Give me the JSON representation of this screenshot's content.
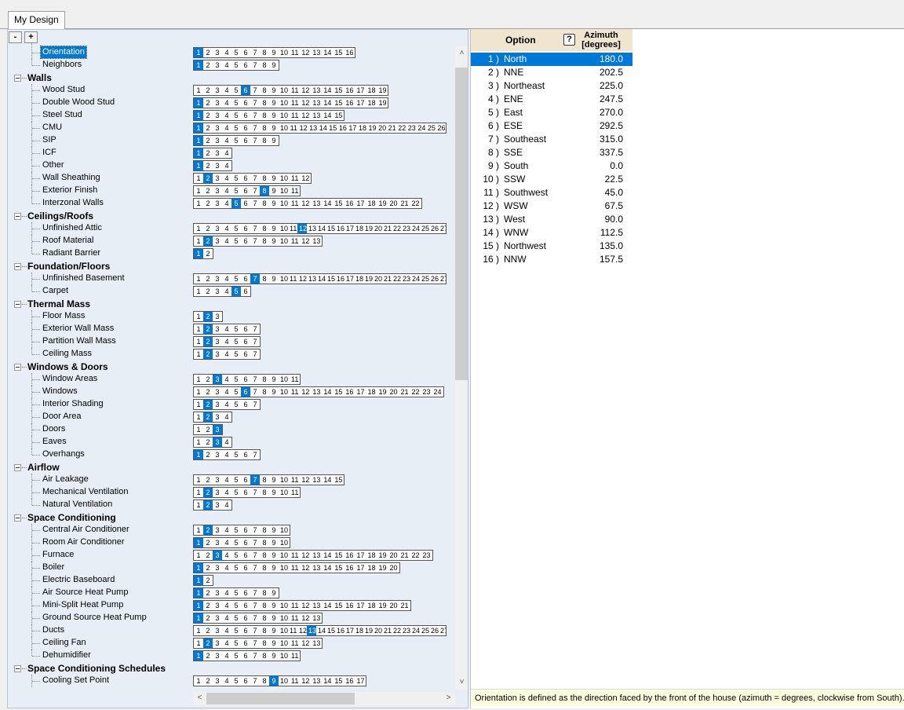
{
  "tab": {
    "label": "My Design"
  },
  "expand_buttons": {
    "collapse": "-",
    "expand": "+"
  },
  "tree": [
    {
      "type": "item",
      "label": "Orientation",
      "count": 16,
      "sel": 1,
      "selected": true,
      "first": true
    },
    {
      "type": "item",
      "label": "Neighbors",
      "count": 9,
      "sel": 1,
      "last": true
    },
    {
      "type": "cat",
      "label": "Walls"
    },
    {
      "type": "item",
      "label": "Wood Stud",
      "count": 19,
      "sel": 6
    },
    {
      "type": "item",
      "label": "Double Wood Stud",
      "count": 19,
      "sel": 1
    },
    {
      "type": "item",
      "label": "Steel Stud",
      "count": 15,
      "sel": 1
    },
    {
      "type": "item",
      "label": "CMU",
      "count": 26,
      "sel": 1
    },
    {
      "type": "item",
      "label": "SIP",
      "count": 9,
      "sel": 1
    },
    {
      "type": "item",
      "label": "ICF",
      "count": 4,
      "sel": 1
    },
    {
      "type": "item",
      "label": "Other",
      "count": 4,
      "sel": 1
    },
    {
      "type": "item",
      "label": "Wall Sheathing",
      "count": 12,
      "sel": 2
    },
    {
      "type": "item",
      "label": "Exterior Finish",
      "count": 11,
      "sel": 8
    },
    {
      "type": "item",
      "label": "Interzonal Walls",
      "count": 22,
      "sel": 5,
      "last": true
    },
    {
      "type": "cat",
      "label": "Ceilings/Roofs"
    },
    {
      "type": "item",
      "label": "Unfinished Attic",
      "count": 27,
      "sel": 12
    },
    {
      "type": "item",
      "label": "Roof Material",
      "count": 13,
      "sel": 2
    },
    {
      "type": "item",
      "label": "Radiant Barrier",
      "count": 2,
      "sel": 1,
      "last": true
    },
    {
      "type": "cat",
      "label": "Foundation/Floors"
    },
    {
      "type": "item",
      "label": "Unfinished Basement",
      "count": 27,
      "sel": 7
    },
    {
      "type": "item",
      "label": "Carpet",
      "count": 6,
      "sel": 5,
      "last": true
    },
    {
      "type": "cat",
      "label": "Thermal Mass"
    },
    {
      "type": "item",
      "label": "Floor Mass",
      "count": 3,
      "sel": 2
    },
    {
      "type": "item",
      "label": "Exterior Wall Mass",
      "count": 7,
      "sel": 2
    },
    {
      "type": "item",
      "label": "Partition Wall Mass",
      "count": 7,
      "sel": 2
    },
    {
      "type": "item",
      "label": "Ceiling Mass",
      "count": 7,
      "sel": 2,
      "last": true
    },
    {
      "type": "cat",
      "label": "Windows & Doors"
    },
    {
      "type": "item",
      "label": "Window Areas",
      "count": 11,
      "sel": 3
    },
    {
      "type": "item",
      "label": "Windows",
      "count": 24,
      "sel": 6
    },
    {
      "type": "item",
      "label": "Interior Shading",
      "count": 7,
      "sel": 2
    },
    {
      "type": "item",
      "label": "Door Area",
      "count": 4,
      "sel": 2
    },
    {
      "type": "item",
      "label": "Doors",
      "count": 3,
      "sel": 3
    },
    {
      "type": "item",
      "label": "Eaves",
      "count": 4,
      "sel": 3
    },
    {
      "type": "item",
      "label": "Overhangs",
      "count": 7,
      "sel": 1,
      "last": true
    },
    {
      "type": "cat",
      "label": "Airflow"
    },
    {
      "type": "item",
      "label": "Air Leakage",
      "count": 15,
      "sel": 7
    },
    {
      "type": "item",
      "label": "Mechanical Ventilation",
      "count": 11,
      "sel": 2
    },
    {
      "type": "item",
      "label": "Natural Ventilation",
      "count": 4,
      "sel": 2,
      "last": true
    },
    {
      "type": "cat",
      "label": "Space Conditioning"
    },
    {
      "type": "item",
      "label": "Central Air Conditioner",
      "count": 10,
      "sel": 2
    },
    {
      "type": "item",
      "label": "Room Air Conditioner",
      "count": 10,
      "sel": 1
    },
    {
      "type": "item",
      "label": "Furnace",
      "count": 23,
      "sel": 3
    },
    {
      "type": "item",
      "label": "Boiler",
      "count": 20,
      "sel": 1
    },
    {
      "type": "item",
      "label": "Electric Baseboard",
      "count": 2,
      "sel": 1
    },
    {
      "type": "item",
      "label": "Air Source Heat Pump",
      "count": 9,
      "sel": 1
    },
    {
      "type": "item",
      "label": "Mini-Split Heat Pump",
      "count": 21,
      "sel": 1
    },
    {
      "type": "item",
      "label": "Ground Source Heat Pump",
      "count": 13,
      "sel": 1
    },
    {
      "type": "item",
      "label": "Ducts",
      "count": 27,
      "sel": 13
    },
    {
      "type": "item",
      "label": "Ceiling Fan",
      "count": 13,
      "sel": 2
    },
    {
      "type": "item",
      "label": "Dehumidifier",
      "count": 11,
      "sel": 1,
      "last": true
    },
    {
      "type": "cat",
      "label": "Space Conditioning Schedules"
    },
    {
      "type": "item",
      "label": "Cooling Set Point",
      "count": 17,
      "sel": 9
    }
  ],
  "grid": {
    "header_option": "Option",
    "header_azimuth_line1": "Azimuth",
    "header_azimuth_line2": "[degrees]",
    "help_icon": "?",
    "rows": [
      {
        "num": "1 )",
        "name": "North",
        "az": "180.0",
        "selected": true
      },
      {
        "num": "2 )",
        "name": "NNE",
        "az": "202.5"
      },
      {
        "num": "3 )",
        "name": "Northeast",
        "az": "225.0"
      },
      {
        "num": "4 )",
        "name": "ENE",
        "az": "247.5"
      },
      {
        "num": "5 )",
        "name": "East",
        "az": "270.0"
      },
      {
        "num": "6 )",
        "name": "ESE",
        "az": "292.5"
      },
      {
        "num": "7 )",
        "name": "Southeast",
        "az": "315.0"
      },
      {
        "num": "8 )",
        "name": "SSE",
        "az": "337.5"
      },
      {
        "num": "9 )",
        "name": "South",
        "az": "0.0"
      },
      {
        "num": "10 )",
        "name": "SSW",
        "az": "22.5"
      },
      {
        "num": "11 )",
        "name": "Southwest",
        "az": "45.0"
      },
      {
        "num": "12 )",
        "name": "WSW",
        "az": "67.5"
      },
      {
        "num": "13 )",
        "name": "West",
        "az": "90.0"
      },
      {
        "num": "14 )",
        "name": "WNW",
        "az": "112.5"
      },
      {
        "num": "15 )",
        "name": "Northwest",
        "az": "135.0"
      },
      {
        "num": "16 )",
        "name": "NNW",
        "az": "157.5"
      }
    ]
  },
  "status_text": "Orientation is defined as the direction faced by the front of the house (azimuth = degrees, clockwise from South).",
  "scroll_arrows": {
    "up": "˄",
    "down": "˅",
    "left": "<",
    "right": ">"
  }
}
